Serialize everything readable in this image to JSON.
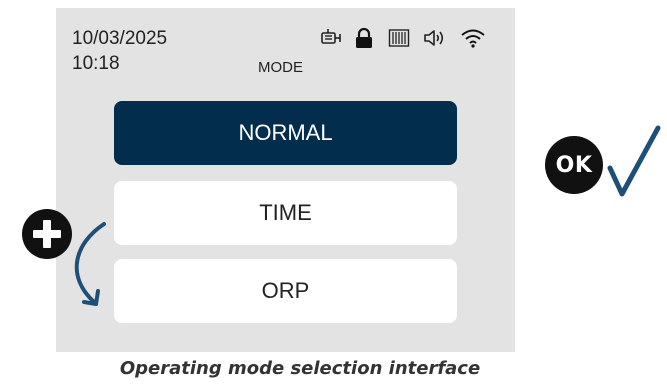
{
  "screen": {
    "date": "10/03/2025",
    "time": "10:18",
    "title": "MODE",
    "status_icons": [
      "pump-icon",
      "lock-icon",
      "filter-icon",
      "volume-icon",
      "wifi-icon"
    ]
  },
  "options": [
    {
      "label": "NORMAL",
      "selected": true
    },
    {
      "label": "TIME",
      "selected": false
    },
    {
      "label": "ORP",
      "selected": false
    }
  ],
  "annotations": {
    "ok_label": "OK",
    "plus_icon": "plus-icon",
    "arrow_icon": "curved-arrow-icon",
    "check_icon": "check-icon"
  },
  "caption": "Operating mode selection interface",
  "colors": {
    "screen_bg": "#e3e3e3",
    "selected_bg": "#032d4c",
    "option_bg": "#ffffff",
    "accent_blue": "#1d4f78",
    "badge_black": "#111111"
  }
}
